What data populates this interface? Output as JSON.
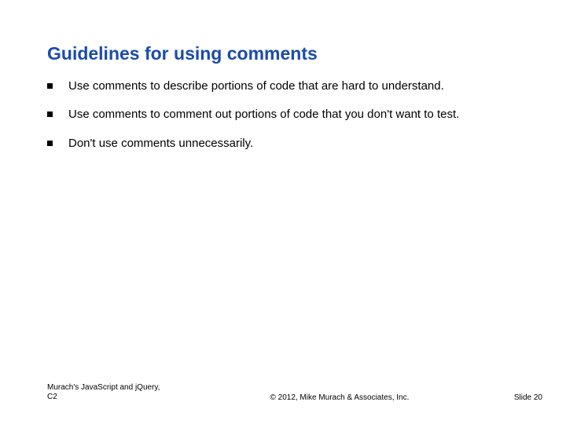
{
  "title": "Guidelines for using comments",
  "bullets": [
    "Use comments to describe portions of code that are hard to understand.",
    "Use comments to comment out portions of code that you don't want to test.",
    "Don't use comments unnecessarily."
  ],
  "footer": {
    "left": "Murach's JavaScript and jQuery, C2",
    "center": "© 2012, Mike Murach & Associates, Inc.",
    "right": "Slide 20"
  }
}
